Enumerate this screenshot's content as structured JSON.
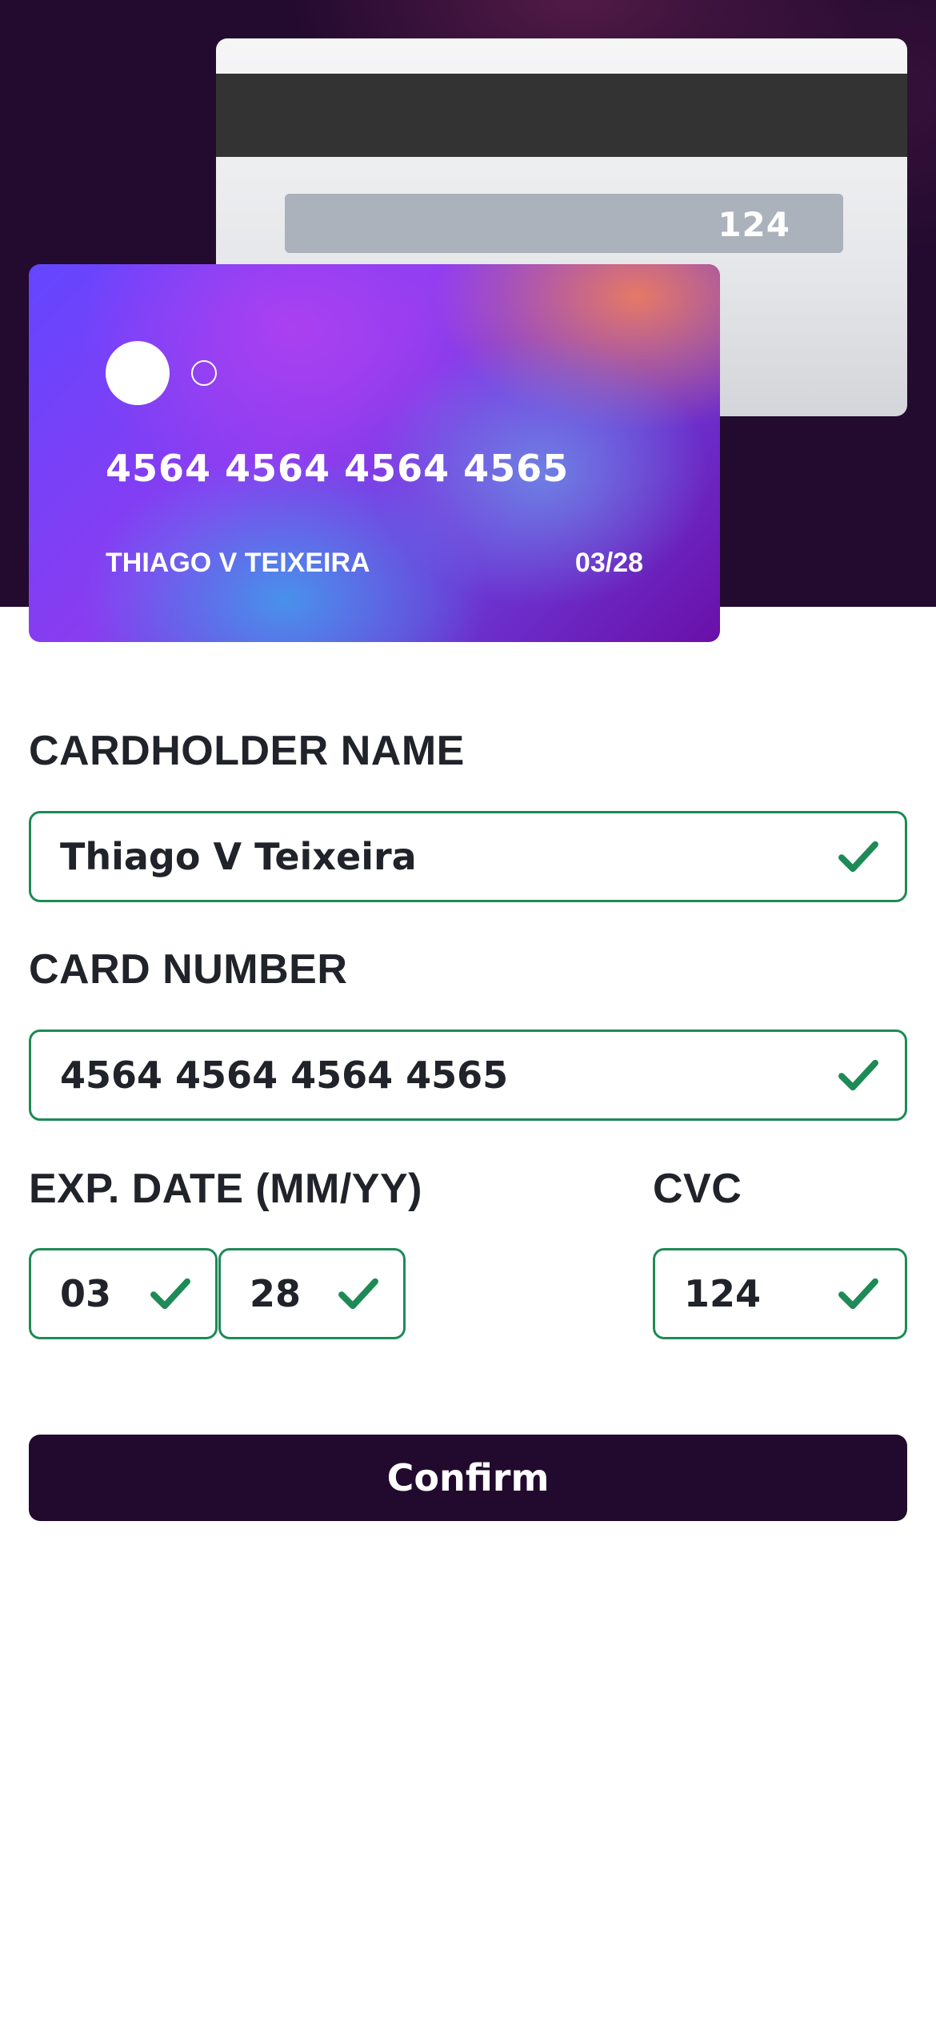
{
  "card_back": {
    "cvc": "124"
  },
  "card_front": {
    "number": "4564 4564 4564 4565",
    "holder": "THIAGO V TEIXEIRA",
    "expiry": "03/28"
  },
  "form": {
    "name_label": "CARDHOLDER NAME",
    "name_value": "Thiago V Teixeira",
    "number_label": "CARD NUMBER",
    "number_value": "4564 4564 4564 4565",
    "exp_label": "EXP. DATE (MM/YY)",
    "exp_month_value": "03",
    "exp_year_value": "28",
    "cvc_label": "CVC",
    "cvc_value": "124",
    "confirm_label": "Confirm"
  },
  "icons": {
    "validated": "check-icon"
  },
  "colors": {
    "hero_bg": "#230a2f",
    "valid_border": "#1e8a56",
    "button_bg": "#220a2e",
    "text": "#21232a"
  }
}
